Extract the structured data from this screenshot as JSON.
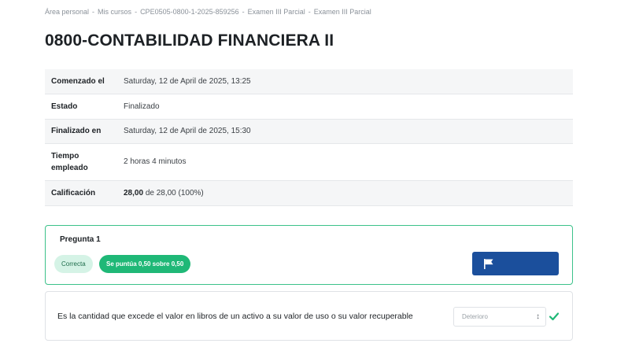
{
  "breadcrumb": [
    "Área personal",
    "Mis cursos",
    "CPE0505-0800-1-2025-859256",
    "Examen III Parcial",
    "Examen III Parcial"
  ],
  "page_title": "0800-CONTABILIDAD FINANCIERA II",
  "summary": {
    "started_label": "Comenzado el",
    "started_value": "Saturday, 12 de April de 2025, 13:25",
    "state_label": "Estado",
    "state_value": "Finalizado",
    "finished_label": "Finalizado en",
    "finished_value": "Saturday, 12 de April de 2025, 15:30",
    "time_label": "Tiempo empleado",
    "time_value": "2 horas 4 minutos",
    "grade_label": "Calificación",
    "grade_score": "28,00",
    "grade_rest": "de 28,00 (100%)"
  },
  "question": {
    "title": "Pregunta 1",
    "status_badge": "Correcta",
    "score_badge": "Se puntúa 0,50 sobre 0,50",
    "flag_icon": "flag-icon"
  },
  "answer": {
    "text": "Es la cantidad que excede el valor en libros de un activo a su valor de uso o su valor recuperable",
    "selected": "Deterioro",
    "check_icon": "check-icon",
    "check_color": "#1fb877"
  }
}
